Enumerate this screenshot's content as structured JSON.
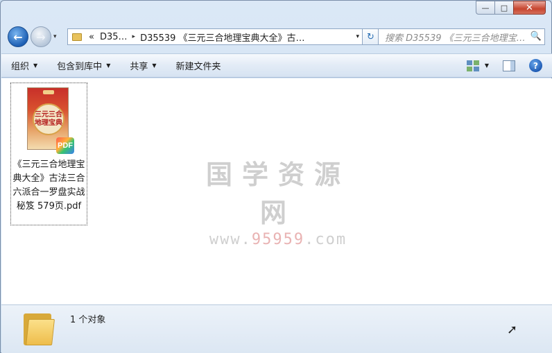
{
  "window": {
    "caption": {
      "minimize": "—",
      "maximize": "□",
      "close": "✕"
    }
  },
  "nav": {
    "back_icon": "←",
    "forward_icon": "→",
    "history_drop": "▾"
  },
  "address": {
    "overflow": "«",
    "crumbs": [
      "D35…",
      "D35539 《三元三合地理宝典大全》古…"
    ],
    "separator": "▸",
    "dropdown": "▾",
    "refresh_icon": "↻"
  },
  "search": {
    "placeholder": "搜索 D35539 《三元三合地理宝…",
    "icon": "🔍"
  },
  "commandbar": {
    "organize": "组织",
    "include_library": "包含到库中",
    "share": "共享",
    "new_folder": "新建文件夹",
    "help_icon": "?"
  },
  "file": {
    "name": "《三元三合地理宝典大全》古法三合六派合一罗盘实战秘笈 579页.pdf",
    "badge": "PDF",
    "cover_lines": [
      "三元三合",
      "地理宝典"
    ]
  },
  "watermark": {
    "main": "国学资源网",
    "url_prefix": "www.",
    "url_highlight": "95959",
    "url_suffix": ".com"
  },
  "details": {
    "count": "1 个对象"
  }
}
